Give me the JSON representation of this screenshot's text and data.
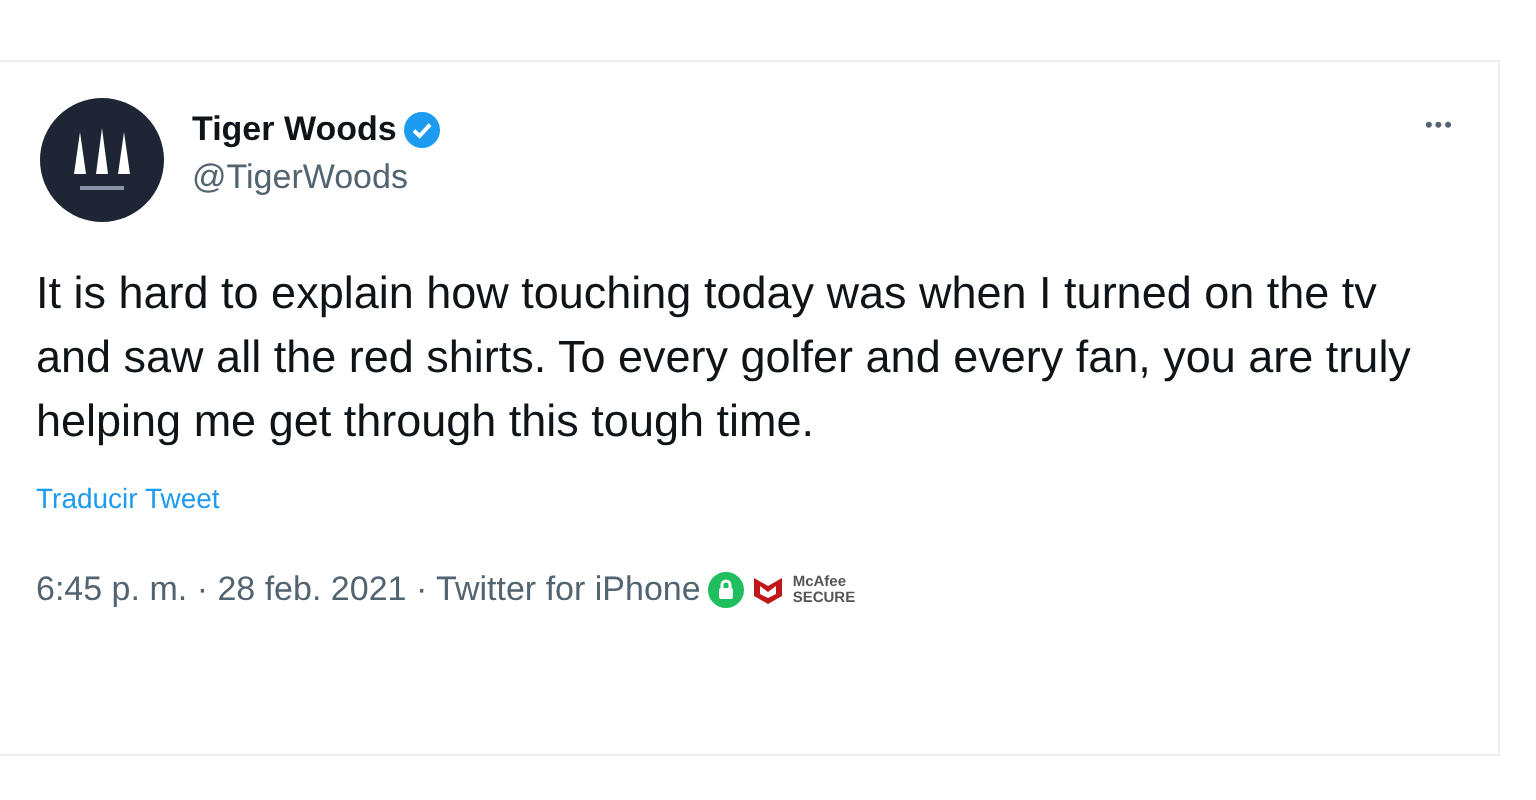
{
  "author": {
    "name": "Tiger Woods",
    "verified": true,
    "handle": "@TigerWoods"
  },
  "more_button": "•••",
  "tweet_text": "It is hard to explain how touching today was when I turned on the tv and saw all the red shirts. To every golfer and every fan, you are truly helping me get through this tough time.",
  "translate_link": "Traducir Tweet",
  "meta": "6:45 p. m. · 28 feb. 2021 · Twitter for iPhone",
  "badge": {
    "line_1": "McAfee",
    "line_2": "SECURE"
  }
}
